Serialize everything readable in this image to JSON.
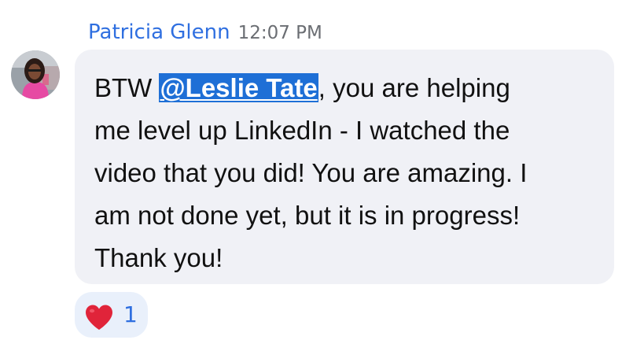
{
  "message": {
    "sender_name": "Patricia Glenn",
    "timestamp": "12:07 PM",
    "text_before_mention": "BTW ",
    "mention": "@Leslie Tate",
    "text_after_mention": ", you are helping",
    "lines": [
      "me level up LinkedIn - I watched the",
      "video that you did! You are amazing. I",
      "am not done yet, but it is in progress!",
      "Thank you!"
    ]
  },
  "reaction": {
    "icon": "heart-icon",
    "count": "1",
    "color": "#e0243a"
  },
  "colors": {
    "sender_name": "#2f6fe0",
    "bubble_background": "#f0f1f6",
    "mention_highlight": "#1e6fd6",
    "reaction_background": "#e9f0fb"
  }
}
